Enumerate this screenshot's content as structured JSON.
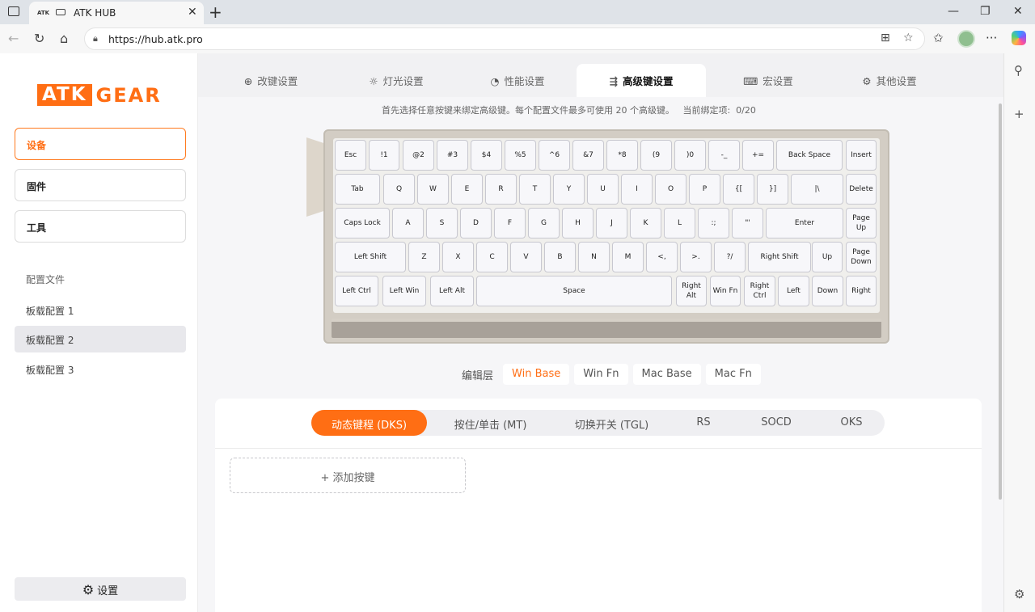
{
  "browser": {
    "tab_title": "ATK HUB",
    "tab_favicon_text": "ATK",
    "url": "https://hub.atk.pro"
  },
  "sidebar": {
    "logo_left": "ATK",
    "logo_right": "GEAR",
    "nav": [
      "设备",
      "固件",
      "工具"
    ],
    "profiles_heading": "配置文件",
    "profiles": [
      "板载配置 1",
      "板载配置 2",
      "板载配置 3"
    ],
    "settings_label": "设置"
  },
  "top_tabs": [
    {
      "label": "改键设置",
      "icon": "keymap-icon"
    },
    {
      "label": "灯光设置",
      "icon": "light-icon"
    },
    {
      "label": "性能设置",
      "icon": "performance-icon"
    },
    {
      "label": "高级键设置",
      "icon": "advanced-key-icon"
    },
    {
      "label": "宏设置",
      "icon": "macro-icon"
    },
    {
      "label": "其他设置",
      "icon": "gear-icon"
    }
  ],
  "hint_text": "首先选择任意按键来绑定高级键。每个配置文件最多可使用 20 个高级键。   当前绑定项:  0/20",
  "keyboard": {
    "rows": [
      [
        "Esc",
        "!1",
        "@2",
        "#3",
        "$4",
        "%5",
        "^6",
        "&7",
        "*8",
        "(9",
        ")0",
        "-_",
        "+=",
        "Back Space",
        "Insert"
      ],
      [
        "Tab",
        "Q",
        "W",
        "E",
        "R",
        "T",
        "Y",
        "U",
        "I",
        "O",
        "P",
        "{[",
        "}]",
        "|\\",
        "Delete"
      ],
      [
        "Caps Lock",
        "A",
        "S",
        "D",
        "F",
        "G",
        "H",
        "J",
        "K",
        "L",
        ":;",
        "\"'",
        "Enter",
        "Page\nUp"
      ],
      [
        "Left Shift",
        "Z",
        "X",
        "C",
        "V",
        "B",
        "N",
        "M",
        "<,",
        ">.",
        "?/",
        "Right Shift",
        "Up",
        "Page\nDown"
      ],
      [
        "Left Ctrl",
        "Left Win",
        "Left Alt",
        "Space",
        "Right\nAlt",
        "Win Fn",
        "Right\nCtrl",
        "Left",
        "Down",
        "Right"
      ]
    ]
  },
  "layers": {
    "label": "编辑层",
    "items": [
      "Win Base",
      "Win Fn",
      "Mac Base",
      "Mac Fn"
    ]
  },
  "modes": [
    "动态键程 (DKS)",
    "按住/单击 (MT)",
    "切换开关 (TGL)",
    "RS",
    "SOCD",
    "OKS"
  ],
  "add_key_label": "+ 添加按键",
  "colors": {
    "accent": "#ff6e14"
  }
}
